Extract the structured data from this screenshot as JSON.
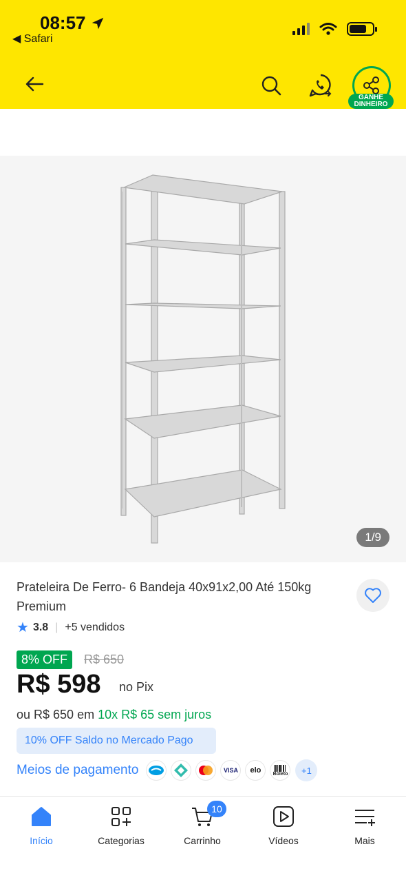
{
  "status_bar": {
    "time": "08:57",
    "back_app": "◀ Safari"
  },
  "header": {
    "earn_badge_line1": "GANHE",
    "earn_badge_line2": "DINHEIRO"
  },
  "gallery": {
    "counter": "1/9"
  },
  "product": {
    "title": "Prateleira De Ferro- 6 Bandeja 40x91x2,00 Até 150kg Premium",
    "rating": "3.8",
    "sold": "+5 vendidos",
    "discount_badge": "8% OFF",
    "old_price": "R$ 650",
    "price": "R$ 598",
    "price_suffix": "no Pix",
    "installment_prefix": "ou R$ 650 em",
    "installment_highlight": "10x R$ 65 sem juros",
    "promo": "10% OFF Saldo no Mercado Pago",
    "payments_label": "Meios de pagamento",
    "payments_more": "+1"
  },
  "payment_icons": [
    "mercado-pago-icon",
    "pix-icon",
    "mastercard-icon",
    "visa-icon",
    "elo-icon",
    "boleto-icon"
  ],
  "payment_icon_text": {
    "visa": "VISA",
    "elo": "elo",
    "boleto": "Boleto"
  },
  "bottom_nav": {
    "tabs": [
      {
        "label": "Início"
      },
      {
        "label": "Categorias"
      },
      {
        "label": "Carrinho"
      },
      {
        "label": "Vídeos"
      },
      {
        "label": "Mais"
      }
    ],
    "cart_count": "10"
  },
  "colors": {
    "header": "#fee600",
    "accent_blue": "#3483fa",
    "green": "#00a650"
  }
}
